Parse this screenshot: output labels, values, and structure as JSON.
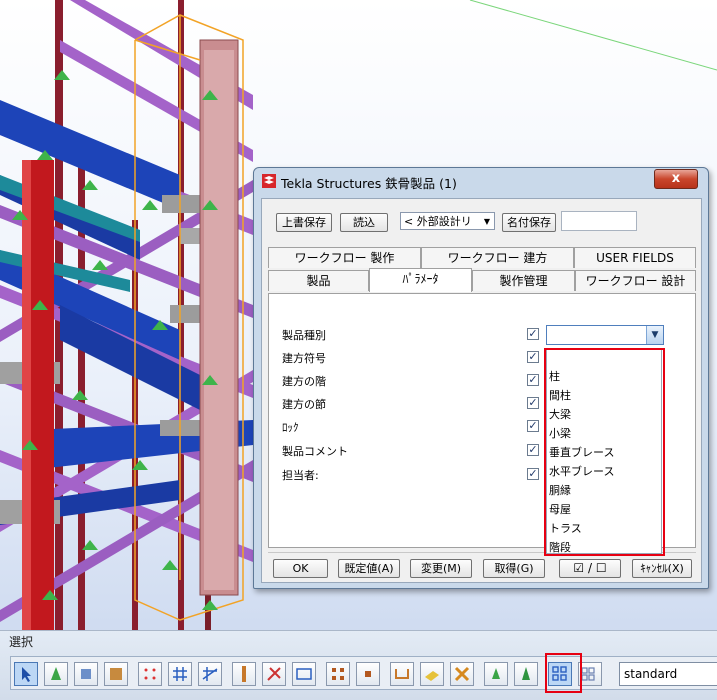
{
  "dialog": {
    "title": "Tekla Structures  鉄骨製品 (1)",
    "close_glyph": "x",
    "save_button": "上書保存",
    "load_button": "読込",
    "preset_value": "< 外部設計リ",
    "save_as_button": "名付保存",
    "save_as_name": "",
    "tabs_row1": [
      "ワークフロー 製作",
      "ワークフロー 建方",
      "USER FIELDS"
    ],
    "tabs_row2": [
      "製品",
      "ﾊﾟﾗﾒｰﾀ",
      "製作管理",
      "ワークフロー 設計"
    ],
    "active_tab": "ﾊﾟﾗﾒｰﾀ",
    "params": [
      {
        "label": "製品種別",
        "checked": true
      },
      {
        "label": "建方符号",
        "checked": true
      },
      {
        "label": "建方の階",
        "checked": true
      },
      {
        "label": "建方の節",
        "checked": true
      },
      {
        "label": "ﾛｯｸ",
        "checked": true
      },
      {
        "label": "製品コメント",
        "checked": true
      },
      {
        "label": "担当者:",
        "checked": true
      }
    ],
    "check_glyph": "✓",
    "product_type_value": "",
    "product_type_options": [
      "",
      "柱",
      "間柱",
      "大梁",
      "小梁",
      "垂直ブレース",
      "水平ブレース",
      "胴縁",
      "母屋",
      "トラス",
      "階段"
    ],
    "buttons": {
      "ok": "OK",
      "defaults": "既定値(A)",
      "modify": "変更(M)",
      "get": "取得(G)",
      "toggle": "☑ / ☐",
      "cancel": "ｷｬﾝｾﾙ(X)"
    }
  },
  "toolbar": {
    "title": "選択",
    "filter_value": "standard"
  },
  "colors": {
    "highlight": "#e60012",
    "dialog_frame": "#c9d9ea",
    "beam_blue": "#1d44b8",
    "brace_purple": "#a463c9",
    "column_red": "#c2181e"
  }
}
